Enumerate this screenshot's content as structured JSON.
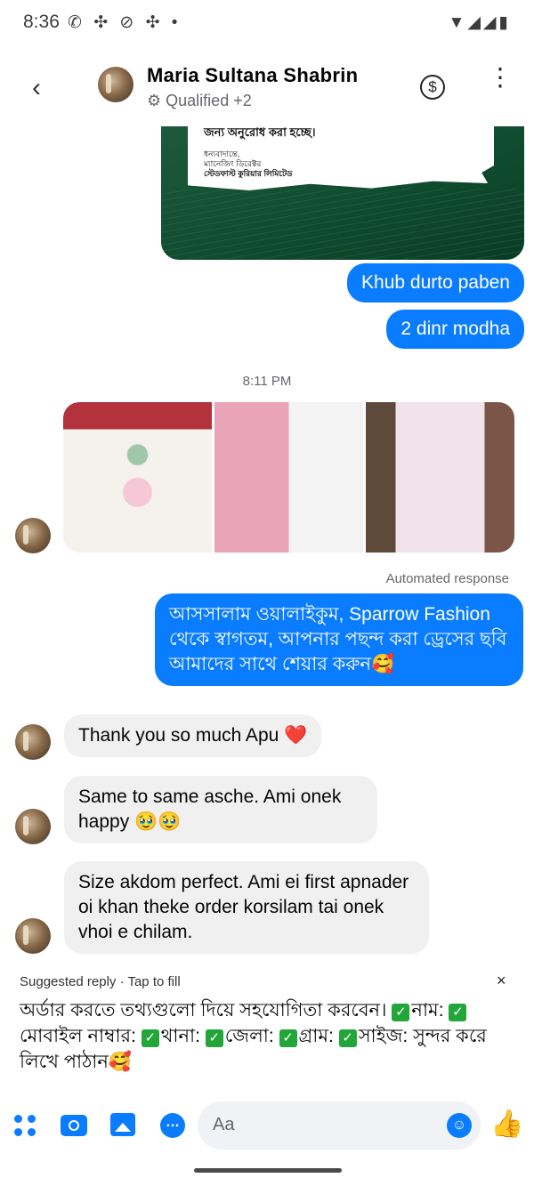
{
  "status_bar": {
    "time": "8:36",
    "left_icons": "✆ ✣ ⊘ ✣ •",
    "right_icons": "▼◢◢▮"
  },
  "header": {
    "name": "Maria Sultana Shabrin",
    "subtitle": "Qualified +2",
    "back_icon": "‹",
    "dollar": "$",
    "menu": "⋮"
  },
  "image_card": {
    "line1": "জন্য অনুরোধ করা হচ্ছে।",
    "line2": "ধন্যবাদান্তে,",
    "line3": "ম্যানেজিং ডিরেক্টর",
    "line4": "স্টেডফাস্ট কুরিয়ার লিমিটেড"
  },
  "messages": {
    "out1": "Khub durto paben",
    "out2": "2 dinr modha",
    "timestamp": "8:11 PM",
    "automated_label": "Automated response",
    "auto_text": "আসসালাম ওয়ালাইকুম, Sparrow Fashion থেকে স্বাগতম, আপনার পছন্দ করা ড্রেসের ছবি আমাদের সাথে শেয়ার করুন🥰",
    "in1": "Thank you so much Apu ❤️",
    "in2": "Same to same asche. Ami onek happy 🥹🥹",
    "in3": "Size akdom perfect. Ami ei first apnader oi khan theke order korsilam tai onek vhoi e chilam."
  },
  "suggestion": {
    "title": "Suggested reply · Tap to fill",
    "close": "×",
    "prefix": "অর্ডার করতে তথ্যগুলো দিয়ে সহযোগিতা করবেন।",
    "f1": "নাম:",
    "f2": "মোবাইল নাম্বার:",
    "f3": "থানা:",
    "f4": "জেলা:",
    "f5": "গ্রাম:",
    "f6": "সাইজ:",
    "suffix": "সুন্দর করে লিখে পাঠান🥰",
    "check": "✓"
  },
  "composer": {
    "placeholder": "Aa",
    "emoji": "☺",
    "like": "👍"
  },
  "colors": {
    "accent": "#0a7cff",
    "incoming_bubble": "#f0f0f0"
  }
}
